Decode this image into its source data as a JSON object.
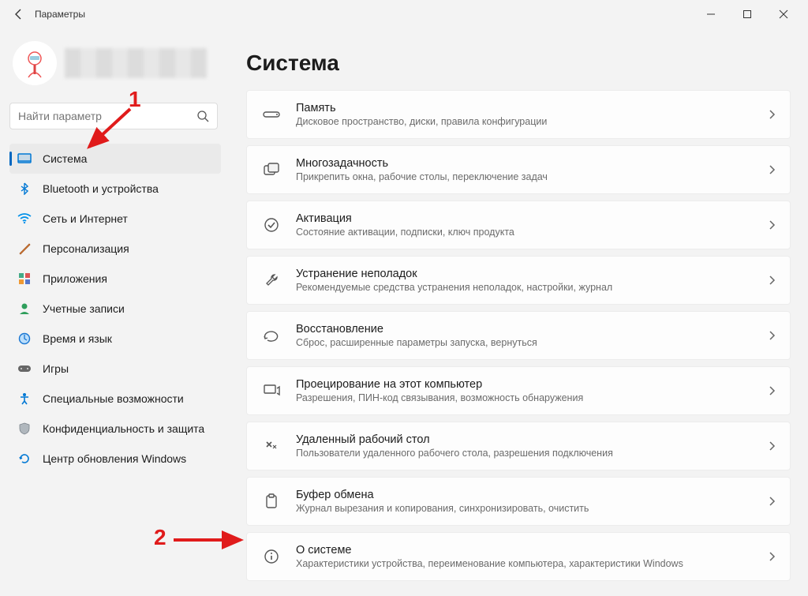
{
  "appTitle": "Параметры",
  "search": {
    "placeholder": "Найти параметр"
  },
  "sidebar": {
    "items": [
      {
        "label": "Система"
      },
      {
        "label": "Bluetooth и устройства"
      },
      {
        "label": "Сеть и Интернет"
      },
      {
        "label": "Персонализация"
      },
      {
        "label": "Приложения"
      },
      {
        "label": "Учетные записи"
      },
      {
        "label": "Время и язык"
      },
      {
        "label": "Игры"
      },
      {
        "label": "Специальные возможности"
      },
      {
        "label": "Конфиденциальность и защита"
      },
      {
        "label": "Центр обновления Windows"
      }
    ]
  },
  "page": {
    "title": "Система"
  },
  "cards": [
    {
      "title": "Память",
      "subtitle": "Дисковое пространство, диски, правила конфигурации"
    },
    {
      "title": "Многозадачность",
      "subtitle": "Прикрепить окна, рабочие столы, переключение задач"
    },
    {
      "title": "Активация",
      "subtitle": "Состояние активации, подписки, ключ продукта"
    },
    {
      "title": "Устранение неполадок",
      "subtitle": "Рекомендуемые средства устранения неполадок, настройки, журнал"
    },
    {
      "title": "Восстановление",
      "subtitle": "Сброс, расширенные параметры запуска, вернуться"
    },
    {
      "title": "Проецирование на этот компьютер",
      "subtitle": "Разрешения, ПИН-код связывания, возможность обнаружения"
    },
    {
      "title": "Удаленный рабочий стол",
      "subtitle": "Пользователи удаленного рабочего стола, разрешения подключения"
    },
    {
      "title": "Буфер обмена",
      "subtitle": "Журнал вырезания и копирования, синхронизировать, очистить"
    },
    {
      "title": "О системе",
      "subtitle": "Характеристики устройства, переименование компьютера, характеристики Windows"
    }
  ],
  "annotations": {
    "step1": "1",
    "step2": "2"
  }
}
